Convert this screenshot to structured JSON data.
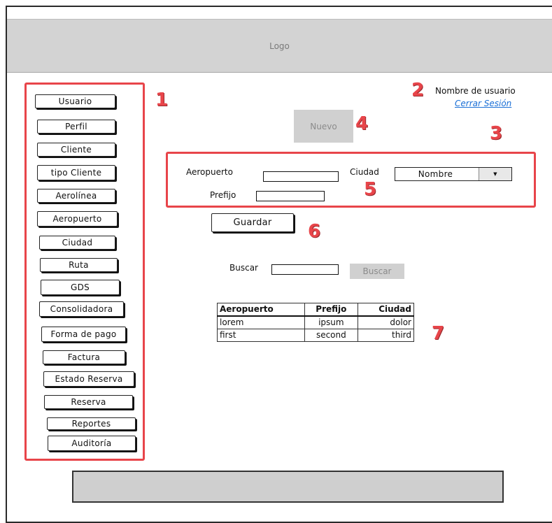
{
  "header": {
    "logo": "Logo"
  },
  "sidebar": {
    "items": [
      {
        "label": "Usuario"
      },
      {
        "label": "Perfil"
      },
      {
        "label": "Cliente"
      },
      {
        "label": "tipo Cliente"
      },
      {
        "label": "Aerolínea"
      },
      {
        "label": "Aeropuerto"
      },
      {
        "label": "Ciudad"
      },
      {
        "label": "Ruta"
      },
      {
        "label": "GDS"
      },
      {
        "label": "Consolidadora"
      },
      {
        "label": "Forma de pago"
      },
      {
        "label": "Factura"
      },
      {
        "label": "Estado Reserva"
      },
      {
        "label": "Reserva"
      },
      {
        "label": "Reportes"
      },
      {
        "label": "Auditoría"
      }
    ]
  },
  "user": {
    "name": "Nombre de usuario",
    "logout": "Cerrar Sesión"
  },
  "actions": {
    "new_label": "Nuevo"
  },
  "form": {
    "airport_label": "Aeropuerto",
    "airport_value": "",
    "city_label": "Ciudad",
    "city_selected": "Nombre",
    "prefix_label": "Prefijo",
    "prefix_value": "",
    "save_label": "Guardar"
  },
  "search": {
    "label": "Buscar",
    "value": "",
    "button_label": "Buscar"
  },
  "table": {
    "headers": [
      "Aeropuerto",
      "Prefijo",
      "Ciudad"
    ],
    "rows": [
      [
        "lorem",
        "ipsum",
        "dolor"
      ],
      [
        "first",
        "second",
        "third"
      ]
    ]
  },
  "annotations": [
    "1",
    "2",
    "3",
    "4",
    "5",
    "6",
    "7"
  ],
  "colors": {
    "annotation": "#e8454a",
    "link": "#1a6fd6",
    "placeholder_gray": "#d3d3d3"
  }
}
